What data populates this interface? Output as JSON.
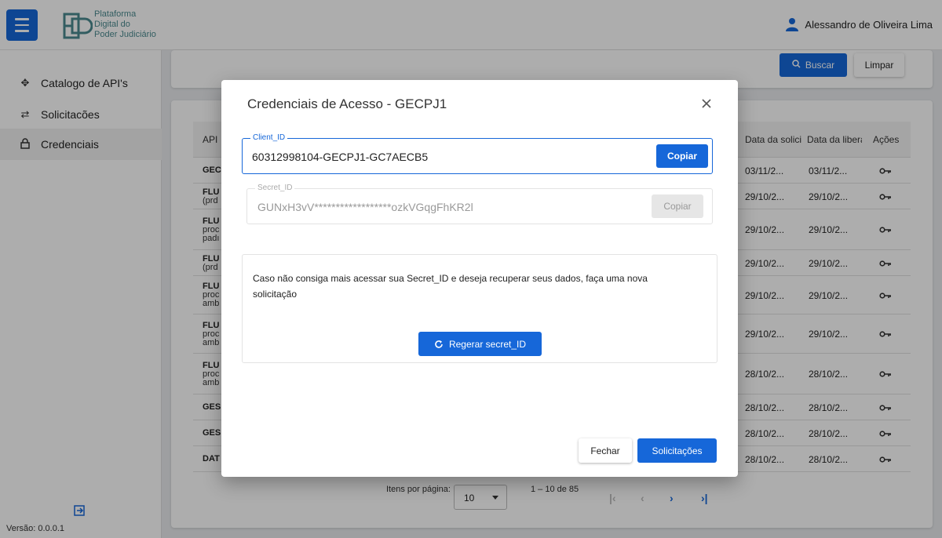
{
  "header": {
    "menu_icon": "hamburger-menu-icon",
    "logo_icon": "pdpj-logo-icon",
    "logo_lines": [
      "Plataforma",
      "Digital do",
      "Poder Judiciário"
    ],
    "user_icon": "person-icon",
    "user_name": "Alessandro de Oliveira Lima",
    "brand_color": "#1667d9",
    "logo_color": "#4a8a8f"
  },
  "sidebar": {
    "items": [
      {
        "label": "Catalogo de API's",
        "icon": "move-arrows-icon",
        "active": false
      },
      {
        "label": "Solicitacões",
        "icon": "swap-x-icon",
        "active": false
      },
      {
        "label": "Credenciais",
        "icon": "lock-icon",
        "active": true
      }
    ],
    "exit_icon": "logout-icon",
    "version": "Versão: 0.0.0.1"
  },
  "filters": {
    "search_label": "Buscar",
    "search_icon": "search-icon",
    "clear_label": "Limpar"
  },
  "table": {
    "columns": [
      "API",
      "Data da solici",
      "Data da libera",
      "Ações"
    ],
    "rows": [
      {
        "api": [
          "GEC"
        ],
        "requested": "03/11/2...",
        "released": "03/11/2..."
      },
      {
        "api": [
          "FLU",
          "(prd"
        ],
        "requested": "29/10/2...",
        "released": "29/10/2..."
      },
      {
        "api": [
          "FLU",
          "proc",
          "padı"
        ],
        "requested": "29/10/2...",
        "released": "29/10/2..."
      },
      {
        "api": [
          "FLU",
          "(prd"
        ],
        "requested": "29/10/2...",
        "released": "29/10/2..."
      },
      {
        "api": [
          "FLU",
          "proc",
          "amb"
        ],
        "requested": "29/10/2...",
        "released": "29/10/2..."
      },
      {
        "api": [
          "FLU",
          "proc",
          "amb"
        ],
        "requested": "29/10/2...",
        "released": "29/10/2..."
      },
      {
        "api": [
          "FLU",
          "proc",
          "amb"
        ],
        "requested": "28/10/2...",
        "released": "28/10/2..."
      },
      {
        "api": [
          "GES"
        ],
        "requested": "28/10/2...",
        "released": "28/10/2..."
      },
      {
        "api": [
          "GES"
        ],
        "requested": "28/10/2...",
        "released": "28/10/2..."
      },
      {
        "api": [
          "DAT"
        ],
        "requested": "28/10/2...",
        "released": "28/10/2..."
      }
    ],
    "action_icon": "key-icon"
  },
  "pagination": {
    "items_per_page_label": "Itens por página:",
    "page_size": "10",
    "range_label": "1 – 10 de 85",
    "first_icon": "first-page-icon",
    "prev_icon": "prev-page-icon",
    "next_icon": "next-page-icon",
    "last_icon": "last-page-icon"
  },
  "modal": {
    "title": "Credenciais de Acesso - GECPJ1",
    "close_icon": "close-icon",
    "client_id": {
      "label": "Client_ID",
      "value": "60312998104-GECPJ1-GC7AECB5",
      "copy_label": "Copiar"
    },
    "secret_id": {
      "label": "Secret_ID",
      "value": "GUNxH3vV******************ozkVGqgFhKR2l",
      "copy_label": "Copiar"
    },
    "info_text": "Caso não consiga mais acessar sua Secret_ID e deseja recuperar seus dados, faça uma nova solicitação",
    "regen_label": "Regerar secret_ID",
    "regen_icon": "refresh-icon",
    "close_label": "Fechar",
    "requests_label": "Solicitações"
  }
}
